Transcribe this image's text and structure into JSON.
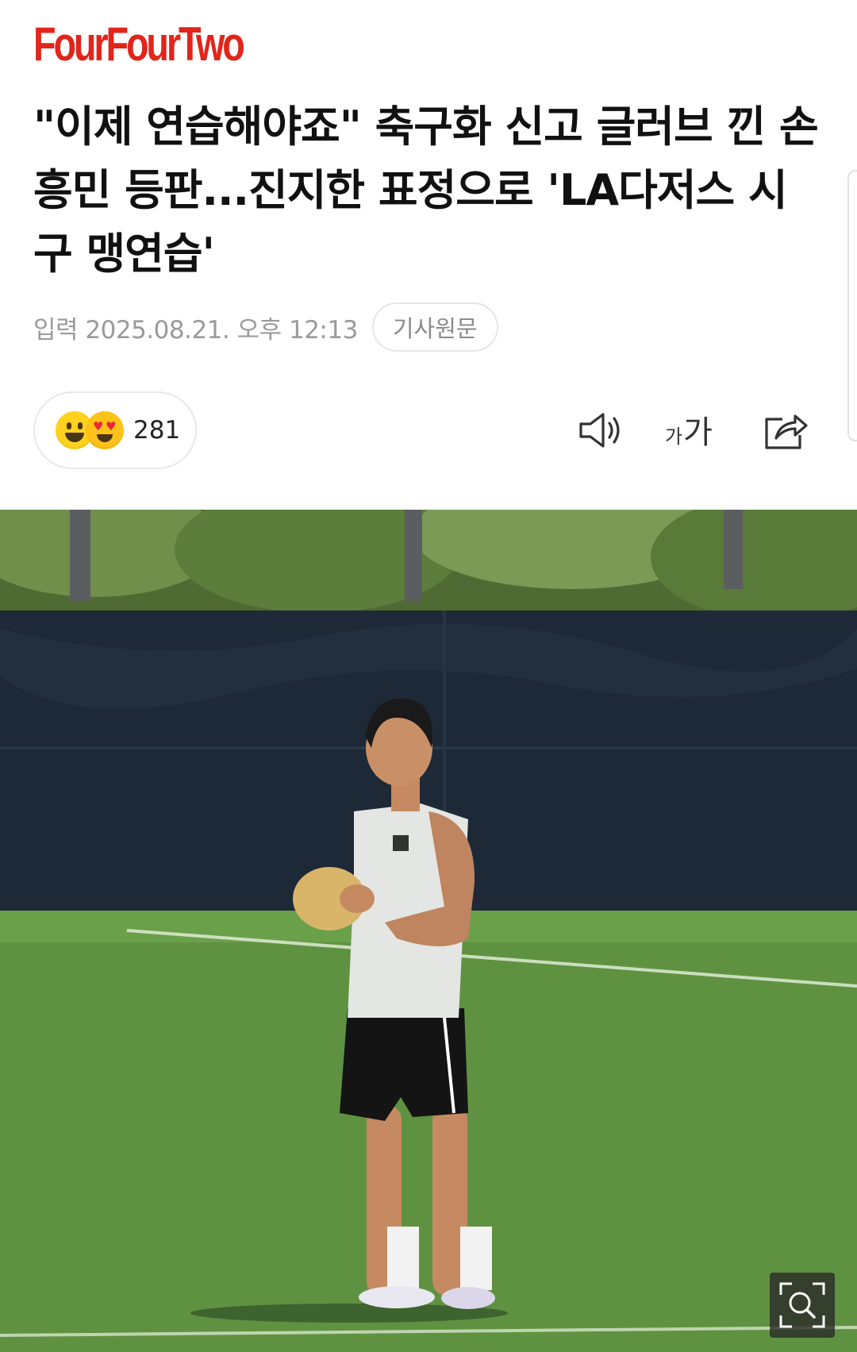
{
  "brand": {
    "logo_text": "FourFourTwo",
    "logo_color": "#e1251b"
  },
  "article": {
    "headline": "\"이제 연습해야죠\" 축구화 신고 글러브 낀 손흥민 등판...진지한 표정으로 'LA다저스 시구 맹연습'",
    "published": "입력 2025.08.21. 오후 12:13",
    "original_link_label": "기사원문"
  },
  "reactions": {
    "count": "281",
    "emojis": [
      "grinning-face-icon",
      "heart-eyes-face-icon"
    ]
  },
  "toolbar": {
    "tts_icon": "speaker-icon",
    "font_small": "가",
    "font_big": "가",
    "share_icon": "share-icon"
  },
  "photo": {
    "zoom_icon": "zoom-search-icon"
  }
}
